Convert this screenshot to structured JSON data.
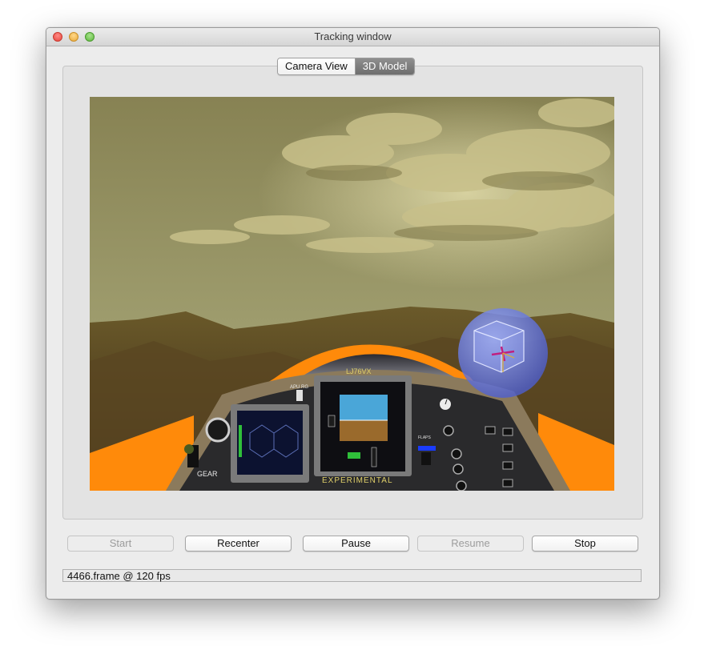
{
  "window": {
    "title": "Tracking window"
  },
  "tabs": {
    "camera_view": "Camera View",
    "model_3d": "3D Model",
    "active": "3D Model"
  },
  "cockpit_text": {
    "tail_code": "LJ76VX",
    "gear": "GEAR",
    "apu": "APU RG",
    "flaps": "FLAPS",
    "brand": "EXPERIMENTAL"
  },
  "buttons": {
    "start": {
      "label": "Start",
      "enabled": false
    },
    "recenter": {
      "label": "Recenter",
      "enabled": true
    },
    "pause": {
      "label": "Pause",
      "enabled": true
    },
    "resume": {
      "label": "Resume",
      "enabled": false
    },
    "stop": {
      "label": "Stop",
      "enabled": true
    }
  },
  "status": {
    "text": "4466.frame @  120 fps"
  },
  "colors": {
    "accent_orange": "#ff8a0a",
    "sky": "#9a9868",
    "tracker_sphere": "#6f80e6"
  }
}
